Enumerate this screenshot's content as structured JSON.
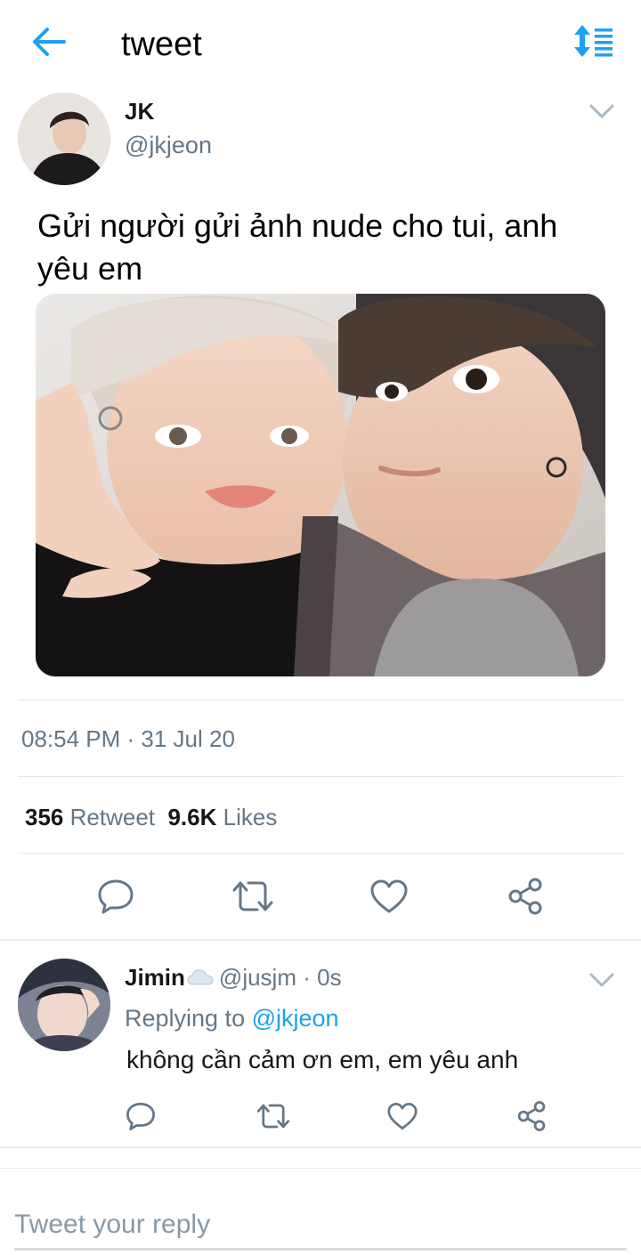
{
  "header": {
    "title": "tweet",
    "back_icon": "arrow-left-icon",
    "sort_icon": "sort-icon",
    "accent_color": "#1da1f2"
  },
  "tweet": {
    "author_name": "JK",
    "author_handle": "@jkjeon",
    "text": "Gửi người gửi ảnh nude cho tui, anh yêu em",
    "timestamp": "08:54 PM · 31 Jul 20",
    "retweet_count": "356",
    "retweet_label": "Retweet",
    "like_count": "9.6K",
    "like_label": "Likes"
  },
  "reply": {
    "author_name": "Jimin",
    "author_emoji": "cloud-icon",
    "author_handle": "@jusjm",
    "time": "· 0s",
    "replying_to_label": "Replying to",
    "replying_to_handle": "@jkjeon",
    "text": "không cần cảm ơn em, em yêu anh"
  },
  "composer": {
    "placeholder": "Tweet your reply"
  }
}
